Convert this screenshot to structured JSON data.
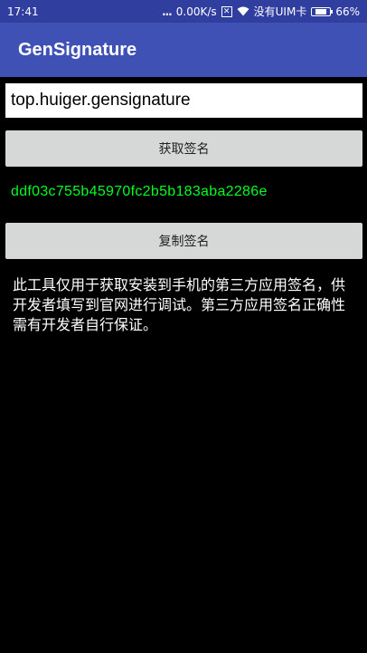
{
  "status_bar": {
    "time": "17:41",
    "dots": "...",
    "speed": "0.00K/s",
    "carrier": "没有UIM卡",
    "battery_percent": "66%",
    "battery_level": 0.66
  },
  "app_bar": {
    "title": "GenSignature"
  },
  "package_input": {
    "value": "top.huiger.gensignature"
  },
  "get_signature_button": {
    "label": "获取签名"
  },
  "signature": {
    "value": "ddf03c755b45970fc2b5b183aba2286e",
    "color": "#00ff22"
  },
  "copy_signature_button": {
    "label": "复制签名"
  },
  "description": {
    "text": "此工具仅用于获取安装到手机的第三方应用签名，供开发者填写到官网进行调试。第三方应用签名正确性需有开发者自行保证。"
  },
  "colors": {
    "status_bar": "#303F9F",
    "app_bar": "#3F51B5",
    "background": "#000000",
    "button": "#d6d7d7"
  }
}
